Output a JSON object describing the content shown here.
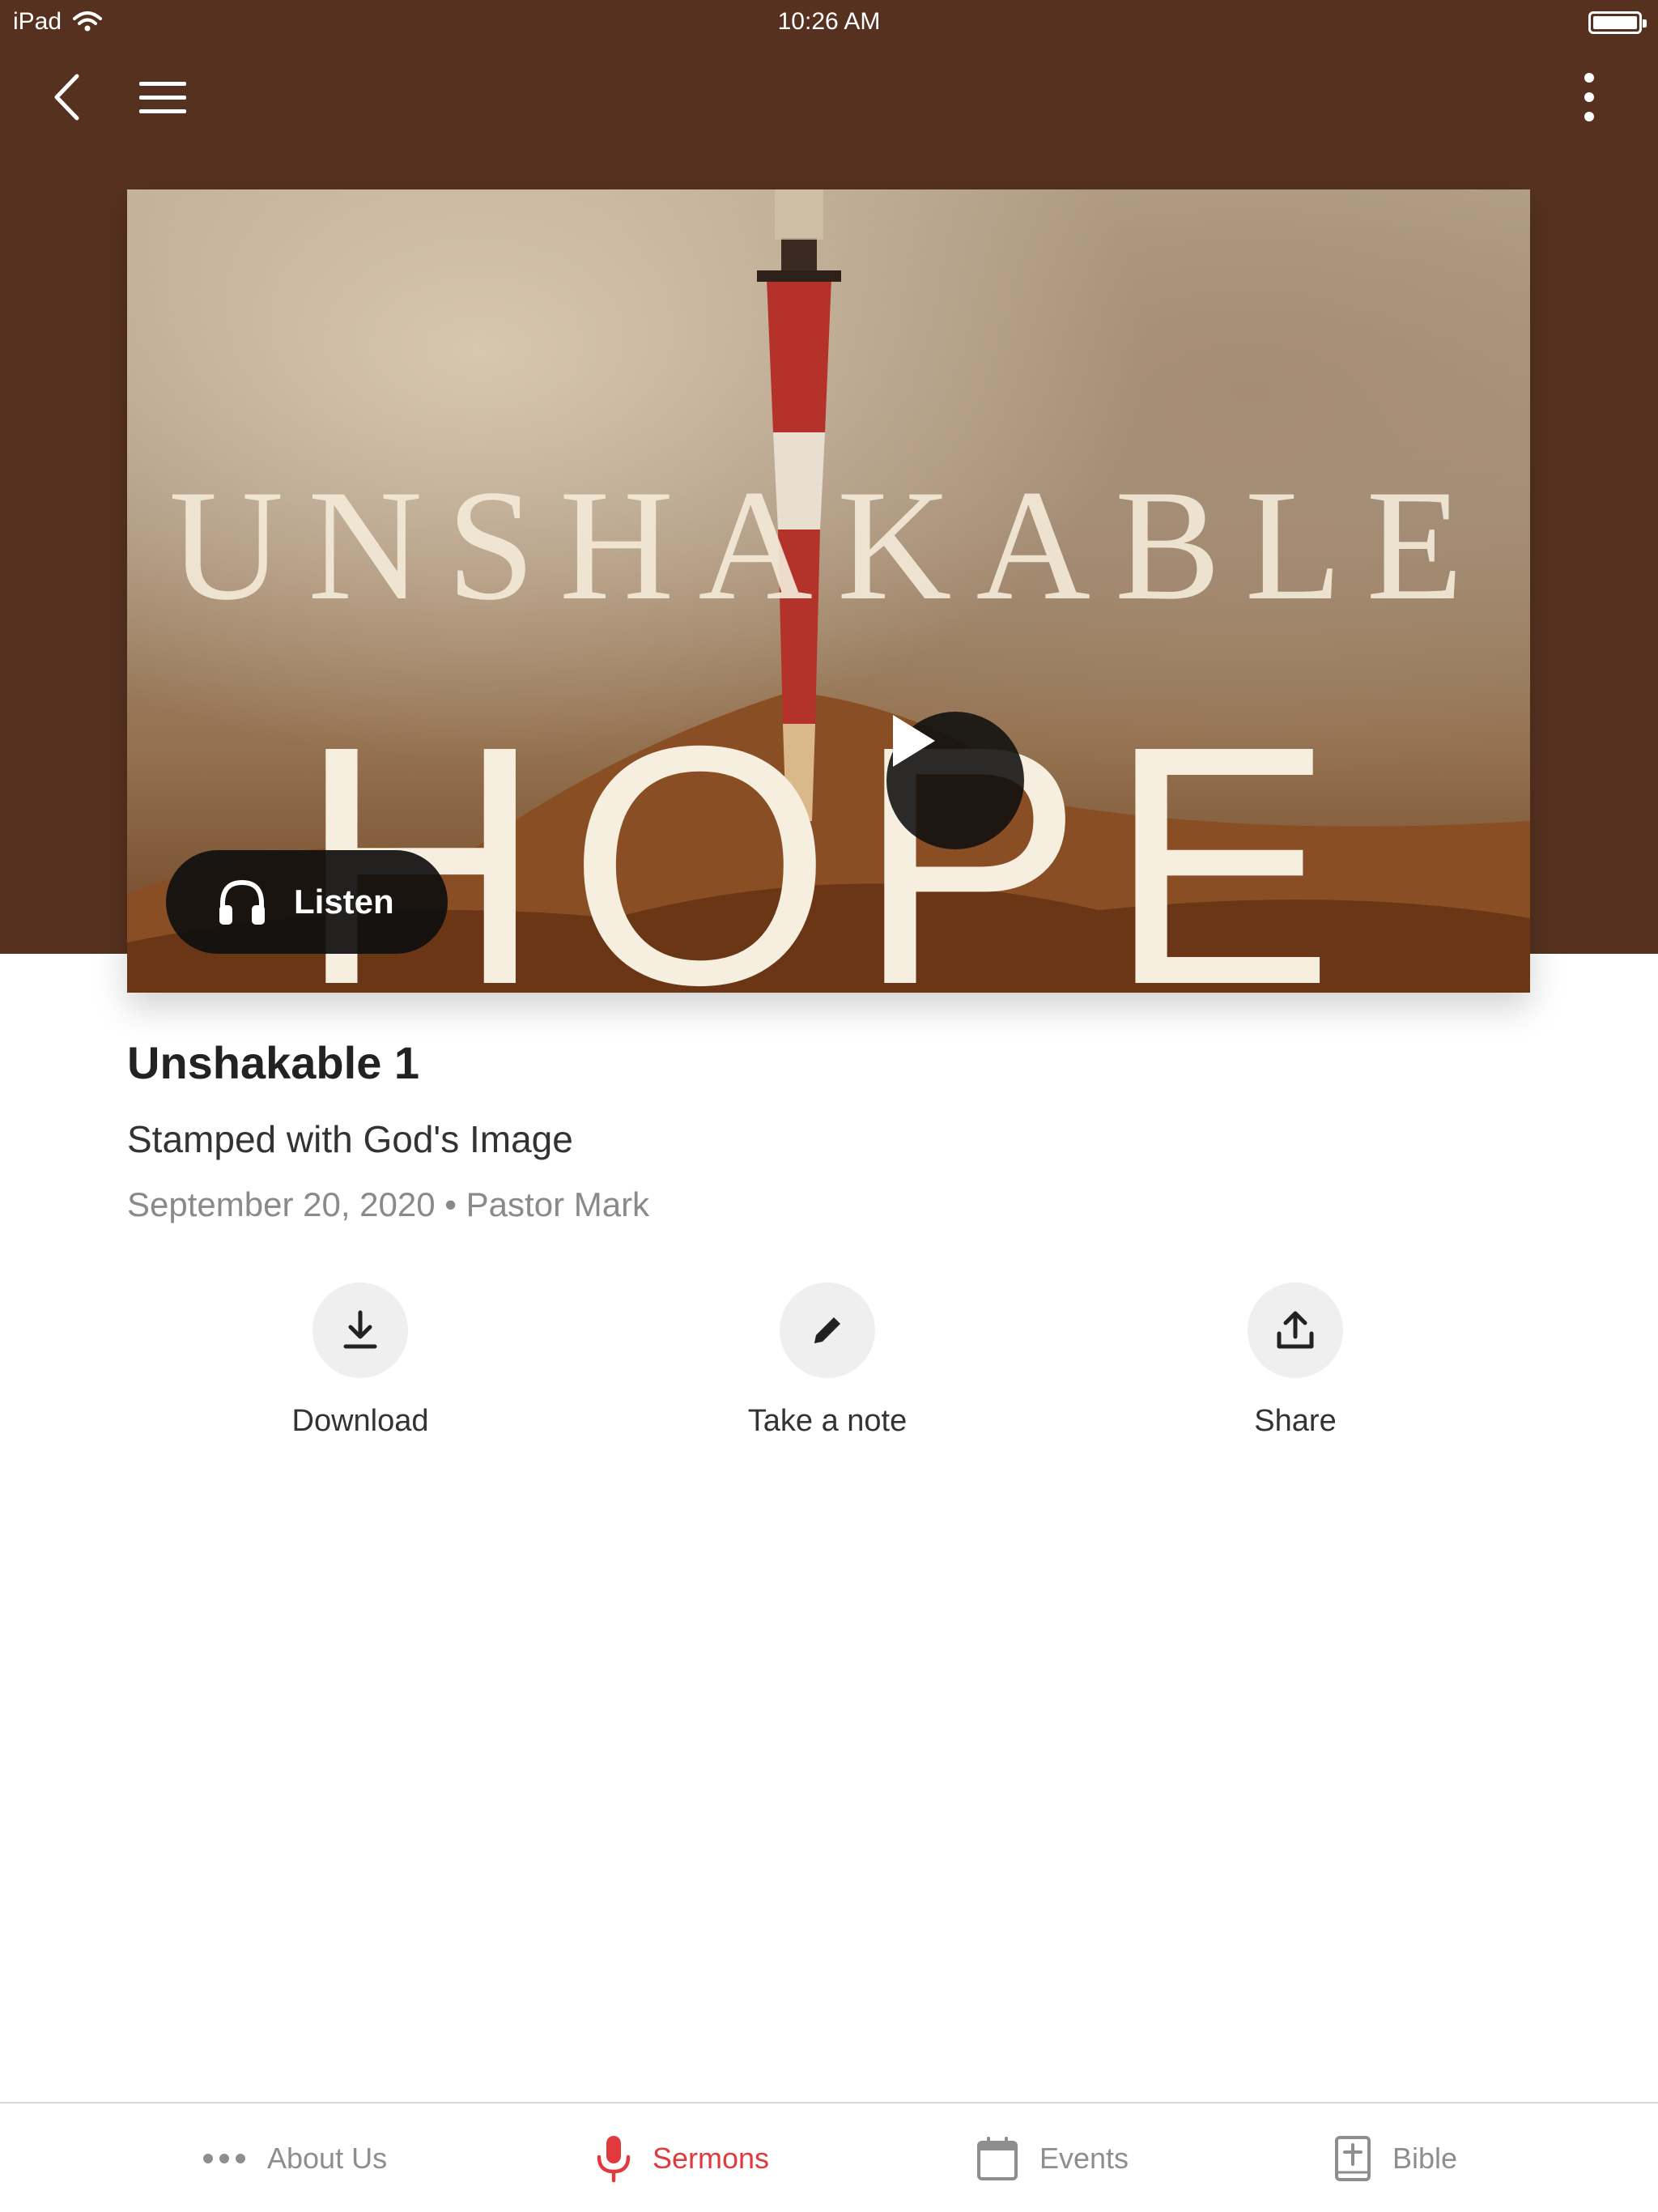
{
  "status_bar": {
    "device": "iPad",
    "time": "10:26 AM"
  },
  "header": {
    "background_color": "#56311f"
  },
  "hero": {
    "artwork_line1": "UNSHAKABLE",
    "artwork_line2": "HOPE",
    "listen_label": "Listen"
  },
  "sermon": {
    "title": "Unshakable 1",
    "subtitle": "Stamped with God's Image",
    "date": "September 20, 2020",
    "separator": "•",
    "speaker": "Pastor Mark"
  },
  "actions": [
    {
      "label": "Download",
      "icon": "download-icon"
    },
    {
      "label": "Take a note",
      "icon": "pencil-icon"
    },
    {
      "label": "Share",
      "icon": "share-icon"
    }
  ],
  "tabs": [
    {
      "label": "About Us",
      "icon": "more-dots-icon",
      "active": false
    },
    {
      "label": "Sermons",
      "icon": "microphone-icon",
      "active": true
    },
    {
      "label": "Events",
      "icon": "calendar-icon",
      "active": false
    },
    {
      "label": "Bible",
      "icon": "bible-icon",
      "active": false
    }
  ],
  "colors": {
    "accent": "#e0393e",
    "inactive_tab": "#8e8e8e"
  }
}
